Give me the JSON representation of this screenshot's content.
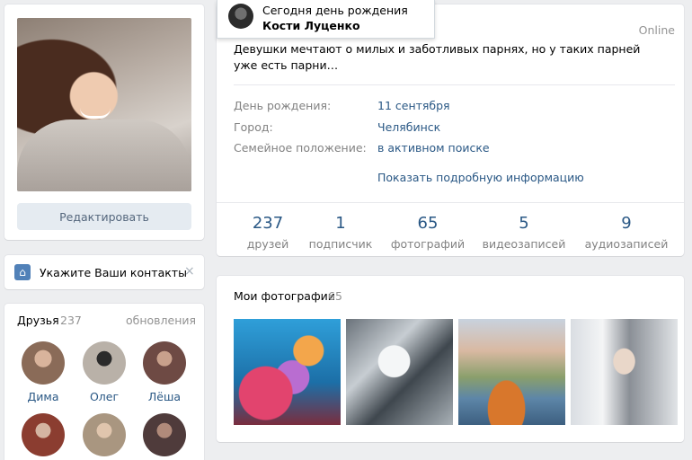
{
  "profile": {
    "edit_label": "Редактировать"
  },
  "contacts_prompt": {
    "label": "Укажите Ваши контакты",
    "close": "×",
    "icon": "home-icon"
  },
  "friends": {
    "title": "Друзья",
    "count": "237",
    "updates": "обновления",
    "items": [
      {
        "name": "Дима",
        "color": "#8a6b58"
      },
      {
        "name": "Олег",
        "color": "#b9b1a8"
      },
      {
        "name": "Лёша",
        "color": "#6e4a44"
      },
      {
        "name": "",
        "color": "#8b3d30"
      },
      {
        "name": "",
        "color": "#a99680"
      },
      {
        "name": "",
        "color": "#4f3b3b"
      }
    ]
  },
  "birthday": {
    "prefix": "Сегодня день рождения ",
    "name": "Кости Луценко"
  },
  "info": {
    "online": "Online",
    "status": "Девушки мечтают о милых и заботливых парнях, но у таких парней уже есть парни…",
    "rows": [
      {
        "label": "День рождения:",
        "value": "11 сентября"
      },
      {
        "label": "Город:",
        "value": "Челябинск"
      },
      {
        "label": "Семейное положение:",
        "value": "в активном поиске"
      }
    ],
    "more": "Показать подробную информацию"
  },
  "stats": [
    {
      "num": "237",
      "label": "друзей"
    },
    {
      "num": "1",
      "label": "подписчик"
    },
    {
      "num": "65",
      "label": "фотографий"
    },
    {
      "num": "5",
      "label": "видеозаписей"
    },
    {
      "num": "9",
      "label": "аудиозаписей"
    }
  ],
  "photos": {
    "title": "Мои фотографии",
    "count": "65"
  },
  "colors": {
    "link": "#2a5885",
    "accent": "#5181b8",
    "muted": "#828282",
    "background": "#edeef0"
  }
}
